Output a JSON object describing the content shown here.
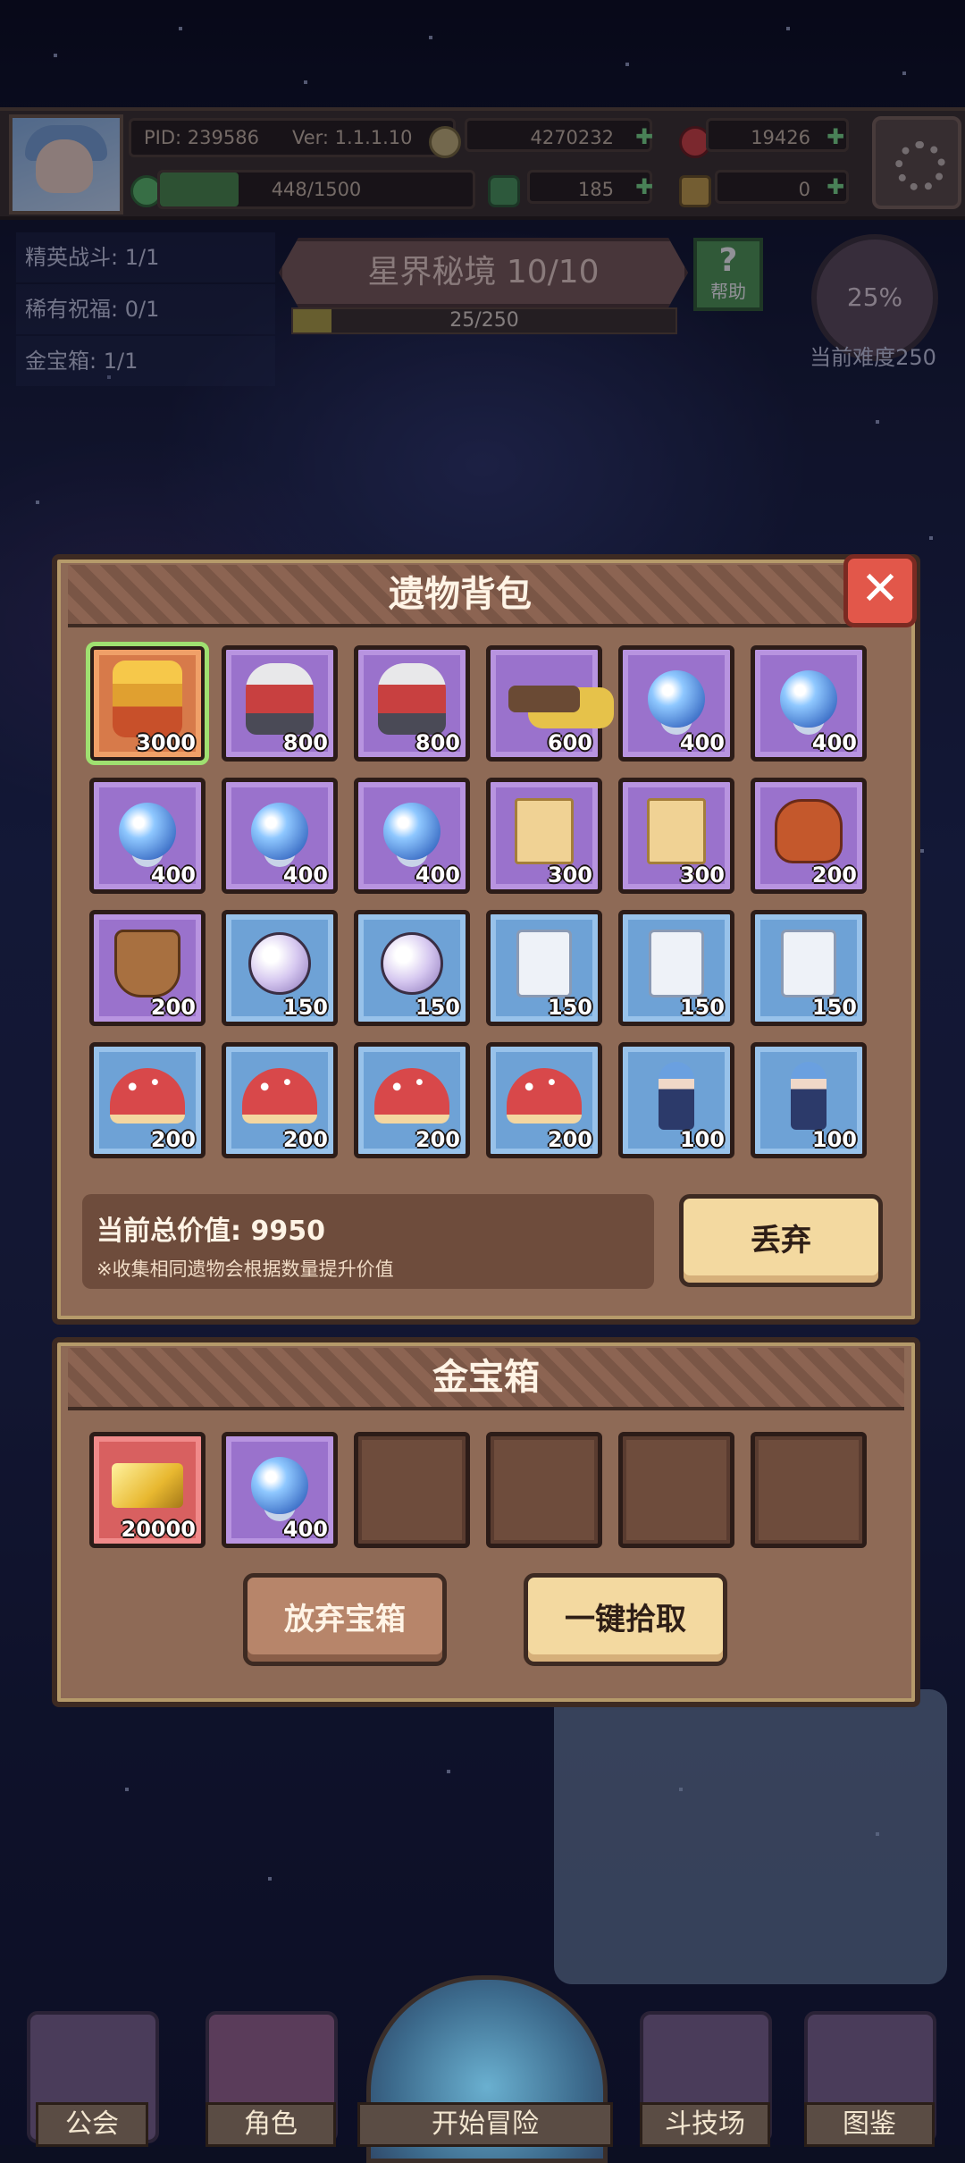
{
  "header": {
    "pid": "PID: 239586",
    "version": "Ver: 1.1.1.10",
    "gold": "4270232",
    "gems": "19426",
    "stamina": "448/1500",
    "clover": "185",
    "keys": "0"
  },
  "quests": [
    {
      "label": "精英战斗: 1/1"
    },
    {
      "label": "稀有祝福: 0/1"
    },
    {
      "label": "金宝箱: 1/1"
    }
  ],
  "stage": {
    "title": "星界秘境 10/10",
    "progress_text": "25/250",
    "progress_fraction": 0.1,
    "help_label": "帮助",
    "help_icon_glyph": "?",
    "difficulty_percent": "25%",
    "difficulty_label": "当前难度250"
  },
  "relic_bag": {
    "title": "遗物背包",
    "close_glyph": "✕",
    "items": [
      {
        "icon": "golden-king-icon",
        "rarity": "orange",
        "value": "3000",
        "selected": true
      },
      {
        "icon": "red-warrior-icon",
        "rarity": "purple",
        "value": "800"
      },
      {
        "icon": "red-warrior-icon",
        "rarity": "purple",
        "value": "800"
      },
      {
        "icon": "spyglass-icon",
        "rarity": "purple",
        "value": "600"
      },
      {
        "icon": "crystal-orb-icon",
        "rarity": "purple",
        "value": "400"
      },
      {
        "icon": "crystal-orb-icon",
        "rarity": "purple",
        "value": "400"
      },
      {
        "icon": "crystal-orb-icon",
        "rarity": "purple",
        "value": "400"
      },
      {
        "icon": "crystal-orb-icon",
        "rarity": "purple",
        "value": "400"
      },
      {
        "icon": "crystal-orb-icon",
        "rarity": "purple",
        "value": "400"
      },
      {
        "icon": "ancient-scroll-icon",
        "rarity": "purple",
        "value": "300"
      },
      {
        "icon": "ancient-scroll-icon",
        "rarity": "purple",
        "value": "300"
      },
      {
        "icon": "treasure-bag-icon",
        "rarity": "purple",
        "value": "200"
      },
      {
        "icon": "bronze-armor-icon",
        "rarity": "purple",
        "value": "200"
      },
      {
        "icon": "pearl-icon",
        "rarity": "blue",
        "value": "150"
      },
      {
        "icon": "pearl-icon",
        "rarity": "blue",
        "value": "150"
      },
      {
        "icon": "stone-tablet-icon",
        "rarity": "blue",
        "value": "150"
      },
      {
        "icon": "stone-tablet-icon",
        "rarity": "blue",
        "value": "150"
      },
      {
        "icon": "stone-tablet-icon",
        "rarity": "blue",
        "value": "150"
      },
      {
        "icon": "mushroom-icon",
        "rarity": "blue",
        "value": "200"
      },
      {
        "icon": "mushroom-icon",
        "rarity": "blue",
        "value": "200"
      },
      {
        "icon": "mushroom-icon",
        "rarity": "blue",
        "value": "200"
      },
      {
        "icon": "mushroom-icon",
        "rarity": "blue",
        "value": "200"
      },
      {
        "icon": "knight-figure-icon",
        "rarity": "blue",
        "value": "100"
      },
      {
        "icon": "knight-figure-icon",
        "rarity": "blue",
        "value": "100"
      }
    ],
    "total_value": "当前总价值: 9950",
    "note": "※收集相同遗物会根据数量提升价值",
    "discard_label": "丢弃"
  },
  "gold_chest": {
    "title": "金宝箱",
    "items": [
      {
        "icon": "gold-ingot-icon",
        "rarity": "red",
        "value": "20000"
      },
      {
        "icon": "crystal-orb-icon",
        "rarity": "purple",
        "value": "400"
      },
      {
        "icon": "",
        "rarity": "empty",
        "value": ""
      },
      {
        "icon": "",
        "rarity": "empty",
        "value": ""
      },
      {
        "icon": "",
        "rarity": "empty",
        "value": ""
      },
      {
        "icon": "",
        "rarity": "empty",
        "value": ""
      }
    ],
    "abandon_label": "放弃宝箱",
    "pickup_label": "一键拾取"
  },
  "nav": {
    "guild": "公会",
    "character": "角色",
    "adventure": "开始冒险",
    "arena": "斗技场",
    "codex": "图鉴"
  },
  "colors": {
    "purple": "#9a72cc",
    "blue": "#6ea2d6",
    "orange": "#d77a4a",
    "red": "#d86060",
    "selected_outline": "#9fe070"
  }
}
